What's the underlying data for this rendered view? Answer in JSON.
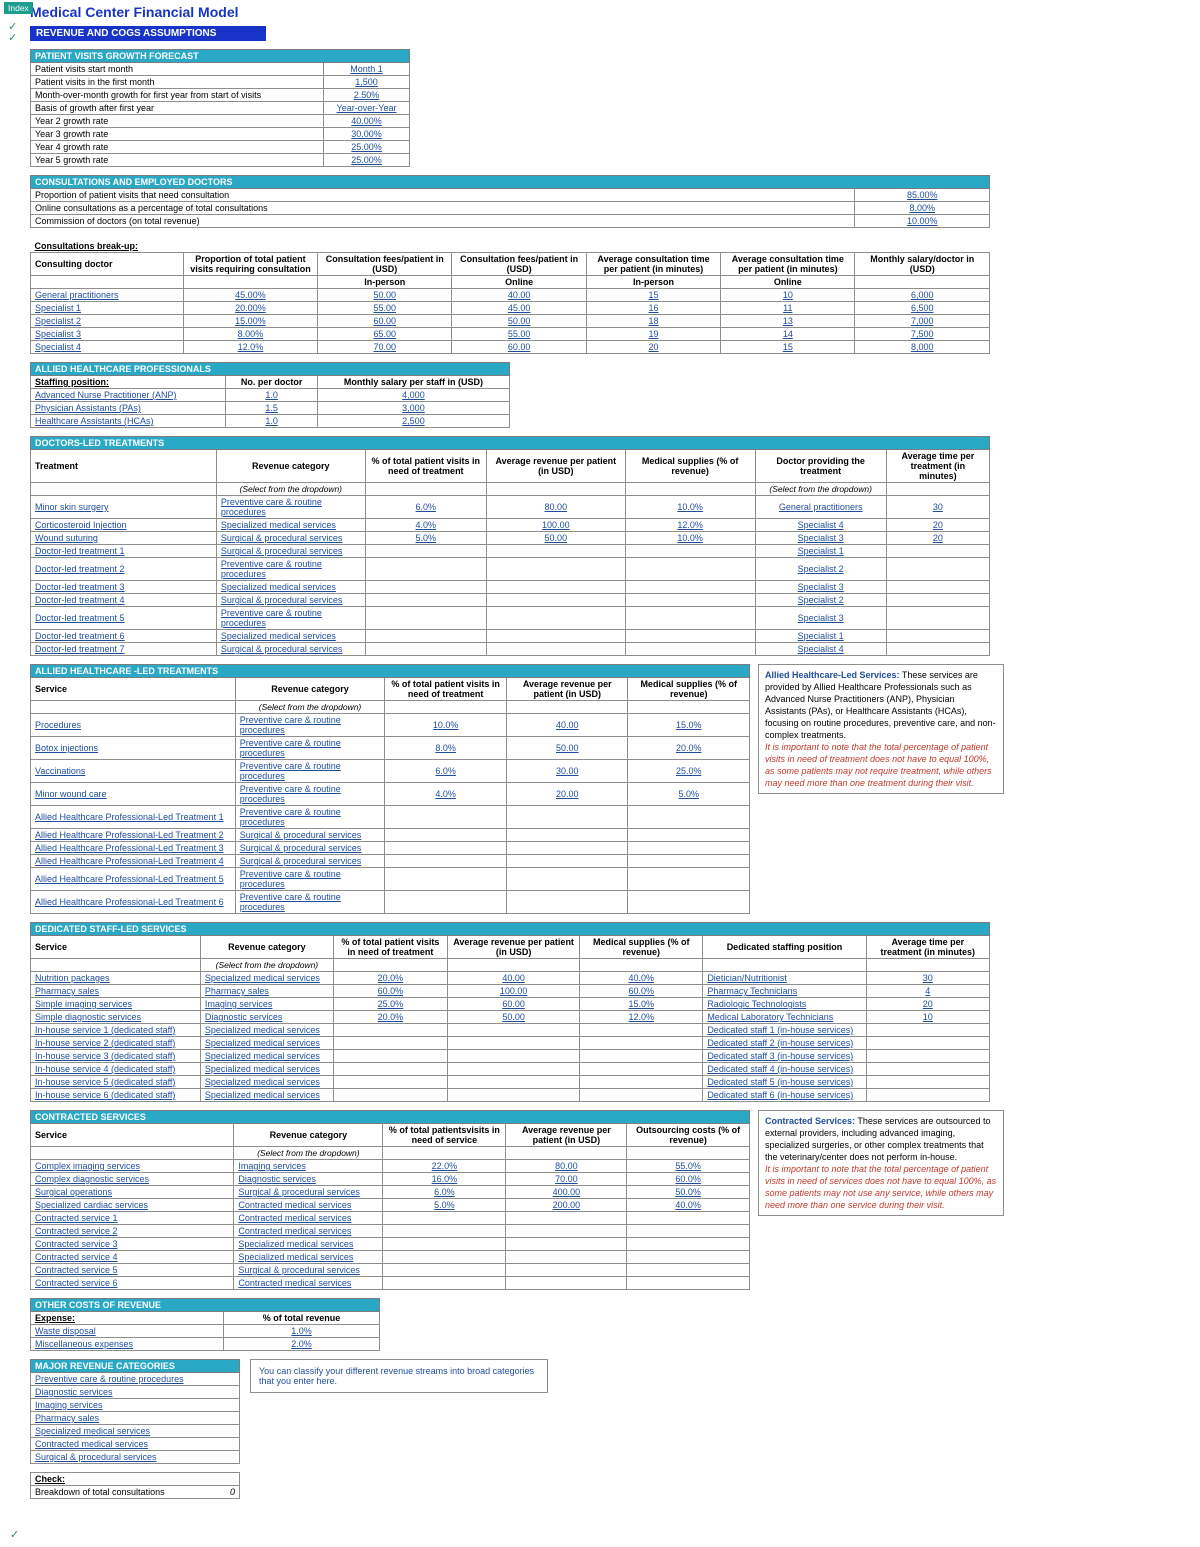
{
  "ui": {
    "index": "Index"
  },
  "page": {
    "title": "Medical Center Financial Model",
    "banner": "REVENUE AND COGS ASSUMPTIONS"
  },
  "growth": {
    "title": "PATIENT VISITS GROWTH FORECAST",
    "rows": [
      {
        "label": "Patient visits start month",
        "val": "Month 1",
        "link": true
      },
      {
        "label": "Patient visits in the first month",
        "val": "1,500",
        "link": true
      },
      {
        "label": "Month-over-month growth for first year from start of visits",
        "val": "2.50%",
        "link": true
      },
      {
        "label": "Basis of growth after first year",
        "val": "Year-over-Year",
        "link": true
      },
      {
        "label": "Year 2 growth rate",
        "val": "40.00%",
        "link": true
      },
      {
        "label": "Year 3 growth rate",
        "val": "30.00%",
        "link": true
      },
      {
        "label": "Year 4 growth rate",
        "val": "25.00%",
        "link": true
      },
      {
        "label": "Year 5 growth rate",
        "val": "25.00%",
        "link": true
      }
    ]
  },
  "consult": {
    "title": "CONSULTATIONS AND EMPLOYED DOCTORS",
    "top": [
      {
        "label": "Proportion of patient visits that need consultation",
        "val": "85.00%"
      },
      {
        "label": "Online consultations as a percentage of total consultations",
        "val": "8.00%"
      },
      {
        "label": "Commission of doctors (on total revenue)",
        "val": "10.00%"
      }
    ],
    "break_label": "Consultations break-up:",
    "headers": [
      "Consulting doctor",
      "Proportion of total patient visits requiring consultation",
      "Consultation fees/patient in (USD)",
      "Consultation fees/patient in (USD)",
      "Average consultation time per patient (in minutes)",
      "Average consultation time per patient (in minutes)",
      "Monthly salary/doctor in (USD)"
    ],
    "sub": [
      "",
      "",
      "In-person",
      "Online",
      "In-person",
      "Online",
      ""
    ],
    "rows": [
      {
        "n": "General practitioners",
        "p": "45.00%",
        "f1": "50.00",
        "f2": "40.00",
        "t1": "15",
        "t2": "10",
        "s": "6,000"
      },
      {
        "n": "Specialist 1",
        "p": "20.00%",
        "f1": "55.00",
        "f2": "45.00",
        "t1": "16",
        "t2": "11",
        "s": "6,500"
      },
      {
        "n": "Specialist 2",
        "p": "15.00%",
        "f1": "60.00",
        "f2": "50.00",
        "t1": "18",
        "t2": "13",
        "s": "7,000"
      },
      {
        "n": "Specialist 3",
        "p": "8.00%",
        "f1": "65.00",
        "f2": "55.00",
        "t1": "19",
        "t2": "14",
        "s": "7,500"
      },
      {
        "n": "Specialist 4",
        "p": "12.0%",
        "f1": "70.00",
        "f2": "60.00",
        "t1": "20",
        "t2": "15",
        "s": "8,000"
      }
    ]
  },
  "allied_pro": {
    "title": "ALLIED HEALTHCARE PROFESSIONALS",
    "h": [
      "Staffing position:",
      "No. per doctor",
      "Monthly salary per staff in (USD)"
    ],
    "rows": [
      {
        "n": "Advanced Nurse Practitioner (ANP)",
        "a": "1.0",
        "b": "4,000"
      },
      {
        "n": "Physician Assistants (PAs)",
        "a": "1.5",
        "b": "3,000"
      },
      {
        "n": "Healthcare Assistants (HCAs)",
        "a": "1.0",
        "b": "2,500"
      }
    ]
  },
  "doctors_led": {
    "title": "DOCTORS-LED TREATMENTS",
    "h": [
      "Treatment",
      "Revenue category",
      "% of total patient visits in need of treatment",
      "Average revenue per patient (in USD)",
      "Medical supplies (% of revenue)",
      "Doctor providing the treatment",
      "Average time per treatment (in minutes)"
    ],
    "hint": "(Select from the dropdown)",
    "hint2": "(Select from the dropdown)",
    "rows": [
      {
        "n": "Minor skin surgery",
        "cat": "Preventive care & routine procedures",
        "p": "6.0%",
        "rev": "80.00",
        "sup": "10.0%",
        "doc": "General practitioners",
        "t": "30"
      },
      {
        "n": "Corticosteroid Injection",
        "cat": "Specialized medical services",
        "p": "4.0%",
        "rev": "100.00",
        "sup": "12.0%",
        "doc": "Specialist 4",
        "t": "20"
      },
      {
        "n": "Wound suturing",
        "cat": "Surgical & procedural services",
        "p": "5.0%",
        "rev": "50.00",
        "sup": "10.0%",
        "doc": "Specialist 3",
        "t": "20"
      },
      {
        "n": "Doctor-led treatment 1",
        "cat": "Surgical & procedural services",
        "p": "",
        "rev": "",
        "sup": "",
        "doc": "Specialist 1",
        "t": ""
      },
      {
        "n": "Doctor-led treatment 2",
        "cat": "Preventive care & routine procedures",
        "p": "",
        "rev": "",
        "sup": "",
        "doc": "Specialist 2",
        "t": ""
      },
      {
        "n": "Doctor-led treatment 3",
        "cat": "Specialized medical services",
        "p": "",
        "rev": "",
        "sup": "",
        "doc": "Specialist 3",
        "t": ""
      },
      {
        "n": "Doctor-led treatment 4",
        "cat": "Surgical & procedural services",
        "p": "",
        "rev": "",
        "sup": "",
        "doc": "Specialist 2",
        "t": ""
      },
      {
        "n": "Doctor-led treatment 5",
        "cat": "Preventive care & routine procedures",
        "p": "",
        "rev": "",
        "sup": "",
        "doc": "Specialist 3",
        "t": ""
      },
      {
        "n": "Doctor-led treatment 6",
        "cat": "Specialized medical services",
        "p": "",
        "rev": "",
        "sup": "",
        "doc": "Specialist 1",
        "t": ""
      },
      {
        "n": "Doctor-led treatment 7",
        "cat": "Surgical & procedural services",
        "p": "",
        "rev": "",
        "sup": "",
        "doc": "Specialist 4",
        "t": ""
      }
    ]
  },
  "allied_led": {
    "title": "ALLIED HEALTHCARE -LED TREATMENTS",
    "h": [
      "Service",
      "Revenue category",
      "% of total patient visits in need of treatment",
      "Average revenue per patient (in USD)",
      "Medical supplies (% of revenue)"
    ],
    "hint": "(Select from the dropdown)",
    "rows": [
      {
        "n": "Procedures",
        "cat": "Preventive care & routine procedures",
        "p": "10.0%",
        "rev": "40.00",
        "sup": "15.0%"
      },
      {
        "n": "Botox injections",
        "cat": "Preventive care & routine procedures",
        "p": "8.0%",
        "rev": "50.00",
        "sup": "20.0%"
      },
      {
        "n": "Vaccinations",
        "cat": "Preventive care & routine procedures",
        "p": "6.0%",
        "rev": "30.00",
        "sup": "25.0%"
      },
      {
        "n": "Minor wound care",
        "cat": "Preventive care & routine procedures",
        "p": "4.0%",
        "rev": "20.00",
        "sup": "5.0%"
      },
      {
        "n": "Allied Healthcare Professional-Led Treatment 1",
        "cat": "Preventive care & routine procedures",
        "p": "",
        "rev": "",
        "sup": ""
      },
      {
        "n": "Allied Healthcare Professional-Led Treatment 2",
        "cat": "Surgical & procedural services",
        "p": "",
        "rev": "",
        "sup": ""
      },
      {
        "n": "Allied Healthcare Professional-Led Treatment 3",
        "cat": "Surgical & procedural services",
        "p": "",
        "rev": "",
        "sup": ""
      },
      {
        "n": "Allied Healthcare Professional-Led Treatment 4",
        "cat": "Surgical & procedural services",
        "p": "",
        "rev": "",
        "sup": ""
      },
      {
        "n": "Allied Healthcare Professional-Led Treatment 5",
        "cat": "Preventive care & routine procedures",
        "p": "",
        "rev": "",
        "sup": ""
      },
      {
        "n": "Allied Healthcare Professional-Led Treatment 6",
        "cat": "Preventive care & routine procedures",
        "p": "",
        "rev": "",
        "sup": ""
      }
    ],
    "info_title": "Allied Healthcare-Led Services:",
    "info_body": " These services are provided by Allied Healthcare Professionals such as Advanced Nurse Practitioners (ANP), Physician Assistants (PAs), or Healthcare Assistants (HCAs), focusing on routine procedures, preventive care, and non-complex treatments.",
    "info_red": "It is important to note that the total percentage of patient visits in need of treatment does not have to equal 100%, as some patients may not require treatment, while others may need more than one treatment during their visit."
  },
  "dedicated": {
    "title": "DEDICATED STAFF-LED SERVICES",
    "h": [
      "Service",
      "Revenue category",
      "% of total patient visits in need of treatment",
      "Average revenue per patient (in USD)",
      "Medical supplies (% of revenue)",
      "Dedicated staffing position",
      "Average time per treatment (in minutes)"
    ],
    "hint": "(Select from the dropdown)",
    "rows": [
      {
        "n": "Nutrition packages",
        "cat": "Specialized medical services",
        "p": "20.0%",
        "rev": "40.00",
        "sup": "40.0%",
        "pos": "Dietician/Nutritionist",
        "t": "30"
      },
      {
        "n": "Pharmacy sales",
        "cat": "Pharmacy sales",
        "p": "60.0%",
        "rev": "100.00",
        "sup": "60.0%",
        "pos": "Pharmacy Technicians",
        "t": "4"
      },
      {
        "n": "Simple imaging services",
        "cat": "Imaging services",
        "p": "25.0%",
        "rev": "60.00",
        "sup": "15.0%",
        "pos": "Radiologic Technologists",
        "t": "20"
      },
      {
        "n": "Simple diagnostic services",
        "cat": "Diagnostic services",
        "p": "20.0%",
        "rev": "50.00",
        "sup": "12.0%",
        "pos": "Medical Laboratory Technicians",
        "t": "10"
      },
      {
        "n": "In-house service 1 (dedicated staff)",
        "cat": "Specialized medical services",
        "p": "",
        "rev": "",
        "sup": "",
        "pos": "Dedicated staff 1 (in-house services)",
        "t": ""
      },
      {
        "n": "In-house service 2 (dedicated staff)",
        "cat": "Specialized medical services",
        "p": "",
        "rev": "",
        "sup": "",
        "pos": "Dedicated staff 2 (in-house services)",
        "t": ""
      },
      {
        "n": "In-house service 3 (dedicated staff)",
        "cat": "Specialized medical services",
        "p": "",
        "rev": "",
        "sup": "",
        "pos": "Dedicated staff 3 (in-house services)",
        "t": ""
      },
      {
        "n": "In-house service 4 (dedicated staff)",
        "cat": "Specialized medical services",
        "p": "",
        "rev": "",
        "sup": "",
        "pos": "Dedicated staff 4 (in-house services)",
        "t": ""
      },
      {
        "n": "In-house service 5 (dedicated staff)",
        "cat": "Specialized medical services",
        "p": "",
        "rev": "",
        "sup": "",
        "pos": "Dedicated staff 5 (in-house services)",
        "t": ""
      },
      {
        "n": "In-house service 6 (dedicated staff)",
        "cat": "Specialized medical services",
        "p": "",
        "rev": "",
        "sup": "",
        "pos": "Dedicated staff 6 (in-house services)",
        "t": ""
      }
    ]
  },
  "contracted": {
    "title": "CONTRACTED SERVICES",
    "h": [
      "Service",
      "Revenue category",
      "% of total patientsvisits in need of service",
      "Average revenue per patient (in USD)",
      "Outsourcing costs (% of revenue)"
    ],
    "hint": "(Select from the dropdown)",
    "rows": [
      {
        "n": "Complex imaging services",
        "cat": "Imaging services",
        "p": "22.0%",
        "rev": "80.00",
        "sup": "55.0%"
      },
      {
        "n": "Complex diagnostic services",
        "cat": "Diagnostic services",
        "p": "16.0%",
        "rev": "70.00",
        "sup": "60.0%"
      },
      {
        "n": "Surgical operations",
        "cat": "Surgical & procedural services",
        "p": "6.0%",
        "rev": "400.00",
        "sup": "50.0%"
      },
      {
        "n": "Specialized cardiac services",
        "cat": "Contracted medical services",
        "p": "5.0%",
        "rev": "200.00",
        "sup": "40.0%"
      },
      {
        "n": "Contracted service 1",
        "cat": "Contracted medical services",
        "p": "",
        "rev": "",
        "sup": ""
      },
      {
        "n": "Contracted service 2",
        "cat": "Contracted medical services",
        "p": "",
        "rev": "",
        "sup": ""
      },
      {
        "n": "Contracted service 3",
        "cat": "Specialized medical services",
        "p": "",
        "rev": "",
        "sup": ""
      },
      {
        "n": "Contracted service 4",
        "cat": "Specialized medical services",
        "p": "",
        "rev": "",
        "sup": ""
      },
      {
        "n": "Contracted service 5",
        "cat": "Surgical & procedural services",
        "p": "",
        "rev": "",
        "sup": ""
      },
      {
        "n": "Contracted service 6",
        "cat": "Contracted medical services",
        "p": "",
        "rev": "",
        "sup": ""
      }
    ],
    "info_title": "Contracted Services:",
    "info_body": " These services are outsourced to external providers, including advanced imaging, specialized surgeries, or other complex treatments that the veterinary/center does not perform in-house.",
    "info_red": "It is important to note that the total percentage of patient visits in need of services does not have to equal 100%, as some patients may not use any service, while others may need more than one service during their visit."
  },
  "other_costs": {
    "title": "OTHER COSTS OF REVENUE",
    "h": [
      "Expense:",
      "% of total revenue"
    ],
    "rows": [
      {
        "n": "Waste disposal",
        "v": "1.0%"
      },
      {
        "n": "Miscellaneous expenses",
        "v": "2.0%"
      }
    ]
  },
  "major": {
    "title": "MAJOR REVENUE CATEGORIES",
    "rows": [
      "Preventive care & routine procedures",
      "Diagnostic services",
      "Imaging services",
      "Pharmacy sales",
      "Specialized medical services",
      "Contracted medical services",
      "Surgical & procedural services"
    ],
    "note": "You can classify your different revenue streams into broad categories that you enter here."
  },
  "check": {
    "title": "Check:",
    "row": "Breakdown of total consultations",
    "val": "0"
  }
}
